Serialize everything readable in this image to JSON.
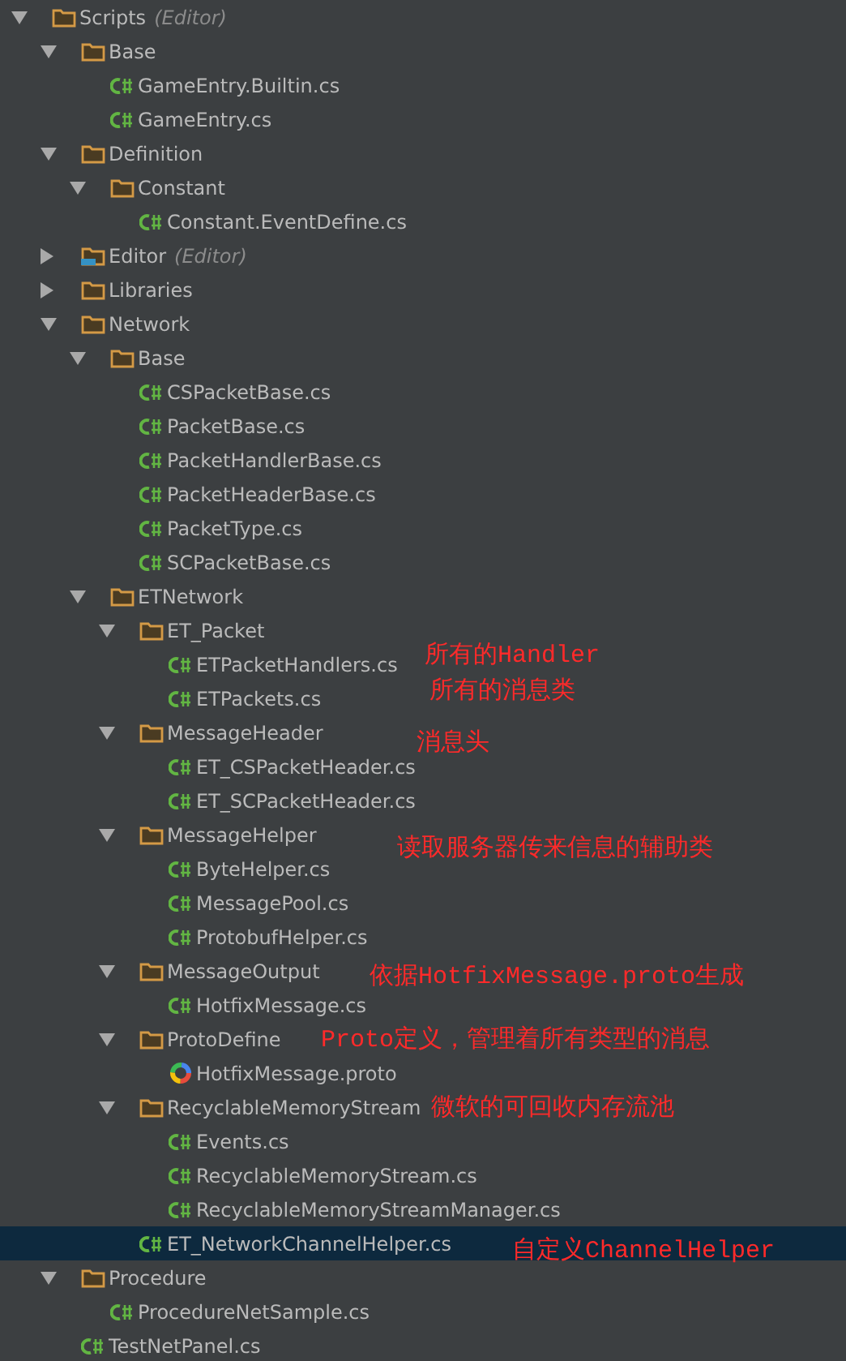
{
  "tree": [
    {
      "name": "Scripts",
      "suffix": "(Editor)",
      "kind": "folder",
      "expanded": true,
      "selected": false,
      "children": [
        {
          "name": "Base",
          "kind": "folder",
          "expanded": true,
          "selected": false,
          "children": [
            {
              "name": "GameEntry.Builtin.cs",
              "kind": "cs",
              "selected": false
            },
            {
              "name": "GameEntry.cs",
              "kind": "cs",
              "selected": false
            }
          ]
        },
        {
          "name": "Definition",
          "kind": "folder",
          "expanded": true,
          "selected": false,
          "children": [
            {
              "name": "Constant",
              "kind": "folder",
              "expanded": true,
              "selected": false,
              "children": [
                {
                  "name": "Constant.EventDefine.cs",
                  "kind": "cs",
                  "selected": false
                }
              ]
            }
          ]
        },
        {
          "name": "Editor",
          "suffix": "(Editor)",
          "kind": "editor_folder",
          "expanded": false,
          "selected": false
        },
        {
          "name": "Libraries",
          "kind": "folder",
          "expanded": false,
          "selected": false
        },
        {
          "name": "Network",
          "kind": "folder",
          "expanded": true,
          "selected": false,
          "children": [
            {
              "name": "Base",
              "kind": "folder",
              "expanded": true,
              "selected": false,
              "children": [
                {
                  "name": "CSPacketBase.cs",
                  "kind": "cs",
                  "selected": false
                },
                {
                  "name": "PacketBase.cs",
                  "kind": "cs",
                  "selected": false
                },
                {
                  "name": "PacketHandlerBase.cs",
                  "kind": "cs",
                  "selected": false
                },
                {
                  "name": "PacketHeaderBase.cs",
                  "kind": "cs",
                  "selected": false
                },
                {
                  "name": "PacketType.cs",
                  "kind": "cs",
                  "selected": false
                },
                {
                  "name": "SCPacketBase.cs",
                  "kind": "cs",
                  "selected": false
                }
              ]
            },
            {
              "name": "ETNetwork",
              "kind": "folder",
              "expanded": true,
              "selected": false,
              "children": [
                {
                  "name": "ET_Packet",
                  "kind": "folder",
                  "expanded": true,
                  "selected": false,
                  "children": [
                    {
                      "name": "ETPacketHandlers.cs",
                      "kind": "cs",
                      "selected": false,
                      "note": "所有的Handler"
                    },
                    {
                      "name": "ETPackets.cs",
                      "kind": "cs",
                      "selected": false,
                      "note": "所有的消息类"
                    }
                  ]
                },
                {
                  "name": "MessageHeader",
                  "kind": "folder",
                  "expanded": true,
                  "selected": false,
                  "note": "消息头",
                  "children": [
                    {
                      "name": "ET_CSPacketHeader.cs",
                      "kind": "cs",
                      "selected": false
                    },
                    {
                      "name": "ET_SCPacketHeader.cs",
                      "kind": "cs",
                      "selected": false
                    }
                  ]
                },
                {
                  "name": "MessageHelper",
                  "kind": "folder",
                  "expanded": true,
                  "selected": false,
                  "note": "读取服务器传来信息的辅助类",
                  "children": [
                    {
                      "name": "ByteHelper.cs",
                      "kind": "cs",
                      "selected": false
                    },
                    {
                      "name": "MessagePool.cs",
                      "kind": "cs",
                      "selected": false
                    },
                    {
                      "name": "ProtobufHelper.cs",
                      "kind": "cs",
                      "selected": false
                    }
                  ]
                },
                {
                  "name": "MessageOutput",
                  "kind": "folder",
                  "expanded": true,
                  "selected": false,
                  "note": "依据HotfixMessage.proto生成",
                  "children": [
                    {
                      "name": "HotfixMessage.cs",
                      "kind": "cs",
                      "selected": false
                    }
                  ]
                },
                {
                  "name": "ProtoDefine",
                  "kind": "folder",
                  "expanded": true,
                  "selected": false,
                  "note": "Proto定义，管理着所有类型的消息",
                  "children": [
                    {
                      "name": "HotfixMessage.proto",
                      "kind": "proto",
                      "selected": false
                    }
                  ]
                },
                {
                  "name": "RecyclableMemoryStream",
                  "kind": "folder",
                  "expanded": true,
                  "selected": false,
                  "note": "微软的可回收内存流池",
                  "children": [
                    {
                      "name": "Events.cs",
                      "kind": "cs",
                      "selected": false
                    },
                    {
                      "name": "RecyclableMemoryStream.cs",
                      "kind": "cs",
                      "selected": false
                    },
                    {
                      "name": "RecyclableMemoryStreamManager.cs",
                      "kind": "cs",
                      "selected": false
                    }
                  ]
                },
                {
                  "name": "ET_NetworkChannelHelper.cs",
                  "kind": "cs",
                  "selected": true,
                  "note": "自定义ChannelHelper"
                }
              ]
            }
          ]
        },
        {
          "name": "Procedure",
          "kind": "folder",
          "expanded": true,
          "selected": false,
          "children": [
            {
              "name": "ProcedureNetSample.cs",
              "kind": "cs",
              "selected": false
            }
          ]
        },
        {
          "name": "TestNetPanel.cs",
          "kind": "cs",
          "selected": false
        }
      ]
    }
  ]
}
